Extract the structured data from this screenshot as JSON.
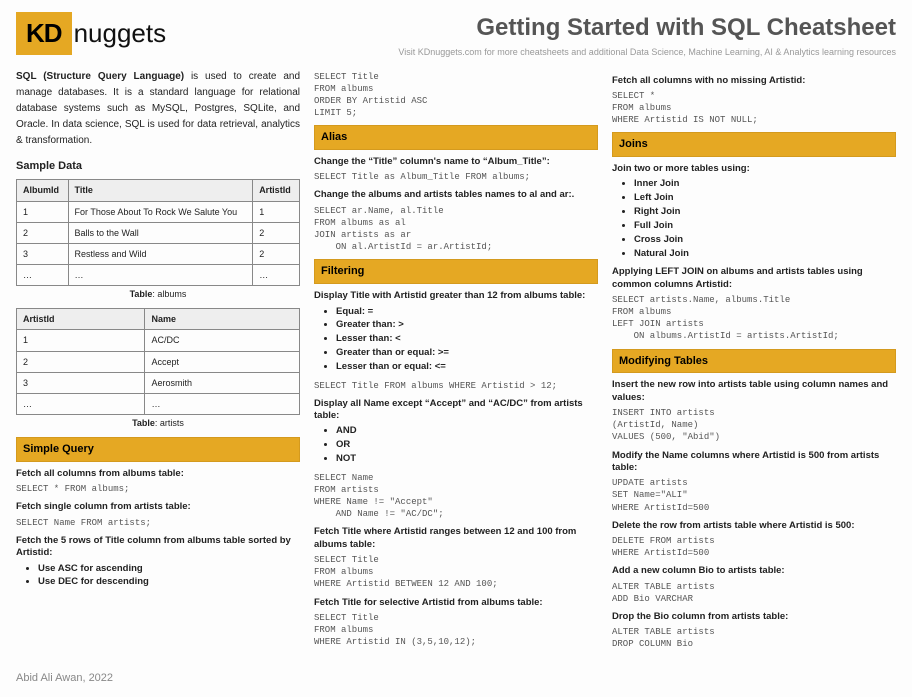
{
  "logo": {
    "box": "KD",
    "text": "nuggets"
  },
  "title": "Getting Started with SQL Cheatsheet",
  "subtitle": "Visit KDnuggets.com for more cheatsheets and additional Data Science, Machine Learning, AI & Analytics learning resources",
  "intro_bold": "SQL (Structure Query Language)",
  "intro_rest": " is used to create and manage databases. It is a standard language for relational database systems such as MySQL, Postgres, SQLite, and Oracle. In data science, SQL is used for data retrieval, analytics & transformation.",
  "sample_data_heading": "Sample Data",
  "albums_headers": [
    "AlbumId",
    "Title",
    "ArtistId"
  ],
  "albums_rows": [
    [
      "1",
      "For Those About To Rock We Salute You",
      "1"
    ],
    [
      "2",
      "Balls to the Wall",
      "2"
    ],
    [
      "3",
      "Restless and Wild",
      "2"
    ],
    [
      "…",
      "…",
      "…"
    ]
  ],
  "albums_caption_label": "Table",
  "albums_caption_name": ": albums",
  "artists_headers": [
    "ArtistId",
    "Name"
  ],
  "artists_rows": [
    [
      "1",
      "AC/DC"
    ],
    [
      "2",
      "Accept"
    ],
    [
      "3",
      "Aerosmith"
    ],
    [
      "…",
      "…"
    ]
  ],
  "artists_caption_label": "Table",
  "artists_caption_name": ": artists",
  "bands": {
    "simple_query": "Simple Query",
    "alias": "Alias",
    "filtering": "Filtering",
    "joins": "Joins",
    "modifying": "Modifying Tables"
  },
  "simple": {
    "d1": "Fetch all columns from albums table:",
    "c1": "SELECT * FROM albums;",
    "d2": "Fetch single column from artists table:",
    "c2": "SELECT Name FROM artists;",
    "d3": "Fetch the 5 rows of Title column from albums table sorted by Artistid:",
    "b1": "Use ASC for ascending",
    "b2": "Use DEC for descending"
  },
  "col2top_code": "SELECT Title\nFROM albums\nORDER BY Artistid ASC\nLIMIT 5;",
  "alias": {
    "d1": "Change the “Title” column's name to “Album_Title”:",
    "c1": "SELECT Title as Album_Title FROM albums;",
    "d2": "Change the albums and artists tables names to al and ar:.",
    "c2": "SELECT ar.Name, al.Title\nFROM albums as al\nJOIN artists as ar\n    ON al.ArtistId = ar.ArtistId;"
  },
  "filtering": {
    "d1": "Display Title with Artistid greater than 12 from albums table:",
    "ops": [
      "Equal: =",
      "Greater than: >",
      "Lesser than: <",
      "Greater than or equal: >=",
      "Lesser than or equal: <="
    ],
    "c1": "SELECT Title FROM albums WHERE Artistid > 12;",
    "d2": "Display all Name except “Accept” and “AC/DC” from artists table:",
    "logic": [
      "AND",
      "OR",
      "NOT"
    ],
    "c2": "SELECT Name\nFROM artists\nWHERE Name != \"Accept\"\n    AND Name != \"AC/DC\";",
    "d3": "Fetch Title where Artistid ranges between 12 and 100 from albums table:",
    "c3": "SELECT Title\nFROM albums\nWHERE Artistid BETWEEN 12 AND 100;",
    "d4": "Fetch Title for selective Artistid from albums table:",
    "c4": "SELECT Title\nFROM albums\nWHERE Artistid IN (3,5,10,12);"
  },
  "col3": {
    "d0": "Fetch all columns with no missing Artistid:",
    "c0": "SELECT *\nFROM albums\nWHERE Artistid IS NOT NULL;"
  },
  "joins": {
    "d1": "Join two or more tables using:",
    "types": [
      "Inner Join",
      "Left Join",
      "Right Join",
      "Full Join",
      "Cross Join",
      "Natural Join"
    ],
    "d2": "Applying LEFT JOIN on albums and artists tables using common columns Artistid:",
    "c2": "SELECT artists.Name, albums.Title\nFROM albums\nLEFT JOIN artists\n    ON albums.ArtistId = artists.ArtistId;"
  },
  "modifying": {
    "d1": "Insert the new row into artists table using column names and values:",
    "c1": "INSERT INTO artists\n(ArtistId, Name)\nVALUES (500, \"Abid\")",
    "d2": "Modify the Name columns where Artistid is 500 from artists table:",
    "c2": "UPDATE artists\nSET Name=\"ALI\"\nWHERE ArtistId=500",
    "d3": "Delete the row from artists table where Artistid is 500:",
    "c3": "DELETE FROM artists\nWHERE ArtistId=500",
    "d4": "Add a new column Bio to artists table:",
    "c4": "ALTER TABLE artists\nADD Bio VARCHAR",
    "d5": "Drop the Bio column from artists table:",
    "c5": "ALTER TABLE artists\nDROP COLUMN Bio"
  },
  "footer": "Abid Ali Awan, 2022"
}
